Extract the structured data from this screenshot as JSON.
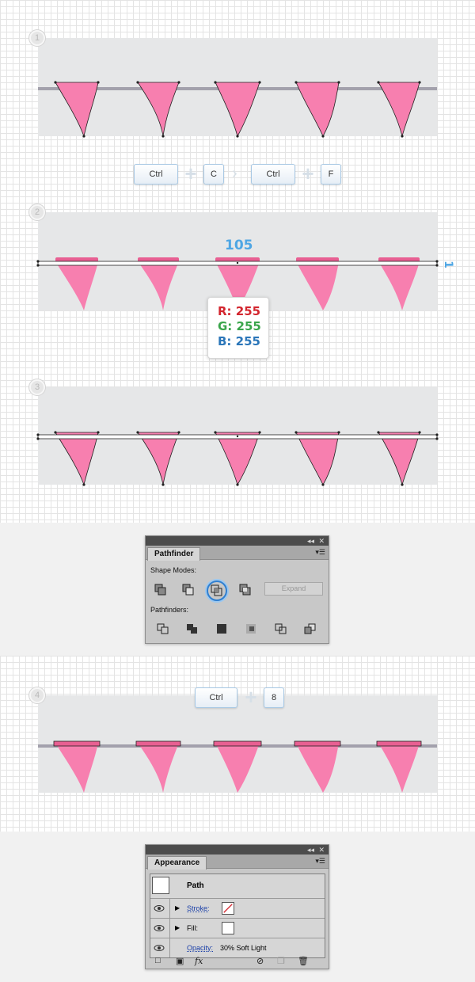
{
  "steps": [
    "1",
    "2",
    "3",
    "4"
  ],
  "shortcut_row_1": {
    "keys": [
      "Ctrl",
      "C",
      "Ctrl",
      "F"
    ]
  },
  "shortcut_row_2": {
    "keys": [
      "Ctrl",
      "8"
    ]
  },
  "measurements": {
    "width_value": "105",
    "height_value": "1"
  },
  "color_callout": {
    "r": "R: 255",
    "g": "G: 255",
    "b": "B: 255"
  },
  "colors": {
    "flag_pink": "#f77faf",
    "flag_pink_dark": "#e85f92",
    "string_gray": "#a3a1ac",
    "canvas_gray": "#e6e7e8",
    "r_color": "#d3262f",
    "g_color": "#3aa54b",
    "b_color": "#2b76b9"
  },
  "pathfinder_panel": {
    "tab": "Pathfinder",
    "shape_modes_label": "Shape Modes:",
    "pathfinders_label": "Pathfinders:",
    "expand_label": "Expand",
    "shape_mode_icons": [
      "unite-icon",
      "minus-front-icon",
      "intersect-icon",
      "exclude-icon"
    ],
    "pathfinder_icons": [
      "divide-icon",
      "trim-icon",
      "merge-icon",
      "crop-icon",
      "outline-icon",
      "minus-back-icon"
    ]
  },
  "appearance_panel": {
    "tab": "Appearance",
    "object_label": "Path",
    "stroke_label": "Stroke:",
    "fill_label": "Fill:",
    "opacity_label": "Opacity:",
    "opacity_value": "30% Soft Light"
  }
}
